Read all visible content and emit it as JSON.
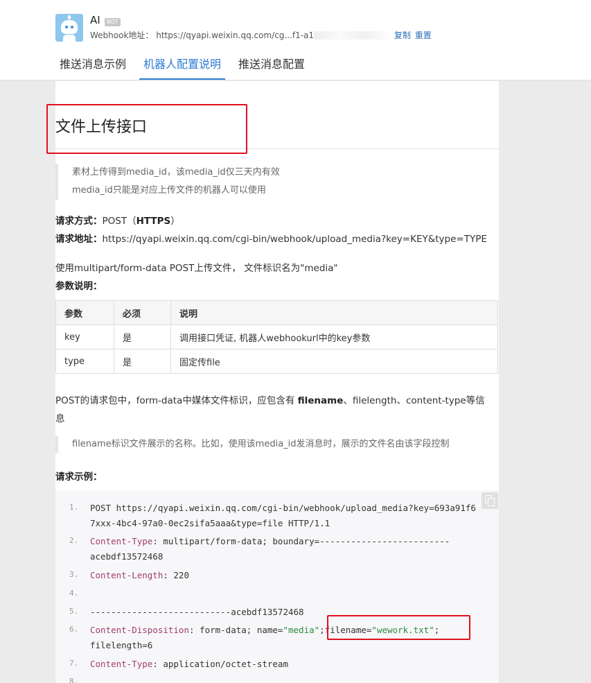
{
  "header": {
    "bot_name": "AI",
    "bot_badge": "BOT",
    "webhook_label": "Webhook地址：",
    "webhook_url": "https://qyapi.weixin.qq.com/cg...f1-a1",
    "copy_label": "复制",
    "reset_label": "重置"
  },
  "tabs": [
    {
      "label": "推送消息示例"
    },
    {
      "label": "机器人配置说明"
    },
    {
      "label": "推送消息配置"
    }
  ],
  "doc": {
    "title": "文件上传接口",
    "notes": [
      "素材上传得到media_id，该media_id仅三天内有效",
      "media_id只能是对应上传文件的机器人可以使用"
    ],
    "method_label": "请求方式：",
    "method_value": "POST（",
    "method_https": "HTTPS",
    "method_close": "）",
    "url_label": "请求地址：",
    "url_value": "https://qyapi.weixin.qq.com/cgi-bin/webhook/upload_media?key=KEY&type=TYPE",
    "multipart_text": "使用multipart/form-data POST上传文件， 文件标识名为\"media\"",
    "params_label": "参数说明：",
    "table_headers": [
      "参数",
      "必须",
      "说明"
    ],
    "table_rows": [
      [
        "key",
        "是",
        "调用接口凭证, 机器人webhookurl中的key参数"
      ],
      [
        "type",
        "是",
        "固定传file"
      ]
    ],
    "post_text_1": "POST的请求包中，form-data中媒体文件标识，应包含有 ",
    "post_filename": "filename",
    "post_text_2": "、filelength、content-type等信",
    "post_text_3": "息",
    "filename_note": "filename标识文件展示的名称。比如，使用该media_id发消息时，展示的文件名由该字段控制",
    "example_label": "请求示例："
  },
  "code": {
    "l1a": "POST https://qyapi.weixin.qq.com/cgi-bin/webhook/upload_media?key=693a91f6",
    "l1b": "7xxx-4bc4-97a0-0ec2sifa5aaa&type=file HTTP/1.1",
    "l2k": "Content-Type",
    "l2v": ": multipart/form-data; boundary=-------------------------",
    "l2b": "acebdf13572468",
    "l3k": "Content-Length",
    "l3v": ": 220",
    "l5": "---------------------------acebdf13572468",
    "l6k": "Content-Disposition",
    "l6v1": ": form-data; name=",
    "l6s1": "\"media\"",
    "l6v2": ";filename=",
    "l6s2": "\"wework.txt\"",
    "l6v3": ";",
    "l6b": "filelength=6",
    "l7k": "Content-Type",
    "l7v": ": application/octet-stream",
    "nums": [
      "1.",
      "2.",
      "3.",
      "4.",
      "5.",
      "6.",
      "7.",
      "8."
    ]
  }
}
